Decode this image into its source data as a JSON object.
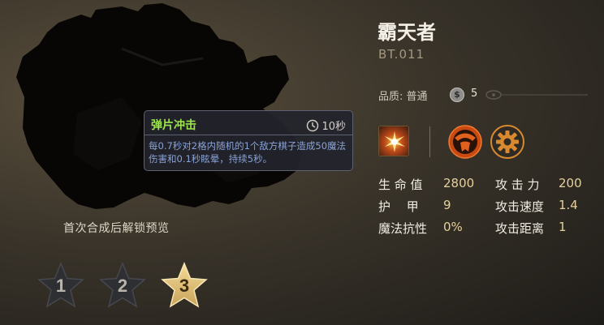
{
  "hero": {
    "name": "霸天者",
    "code": "BT.011",
    "quality_label": "品质: 普通",
    "cost_symbol": "$",
    "cost": "5"
  },
  "unlock_text": "首次合成后解锁预览",
  "star_levels": [
    {
      "label": "1",
      "selected": false
    },
    {
      "label": "2",
      "selected": false
    },
    {
      "label": "3",
      "selected": true
    }
  ],
  "skill_tooltip": {
    "title": "弹片冲击",
    "cooldown": "10秒",
    "description": "每0.7秒对2格内随机的1个敌方棋子造成50魔法伤害和0.1秒眩晕，持续5秒。"
  },
  "icons": {
    "skill": "shrapnel-blast-icon",
    "trait1": "faction-emblem-icon",
    "trait2": "mech-gear-icon",
    "clock": "clock-icon",
    "coin": "coin-icon"
  },
  "stats": [
    {
      "label": "生 命 值",
      "value": "2800"
    },
    {
      "label": "攻 击 力",
      "value": "200"
    },
    {
      "label": "护　 甲",
      "value": "9"
    },
    {
      "label": "攻击速度",
      "value": "1.4"
    },
    {
      "label": "魔法抗性",
      "value": "0%"
    },
    {
      "label": "攻击距离",
      "value": "1"
    }
  ],
  "colors": {
    "skill_title": "#9ce54a",
    "skill_desc": "#8aa3d6",
    "stat_value": "#e6d19c",
    "trait_orange": "#e0601e",
    "star_gold": "#e8c878"
  }
}
